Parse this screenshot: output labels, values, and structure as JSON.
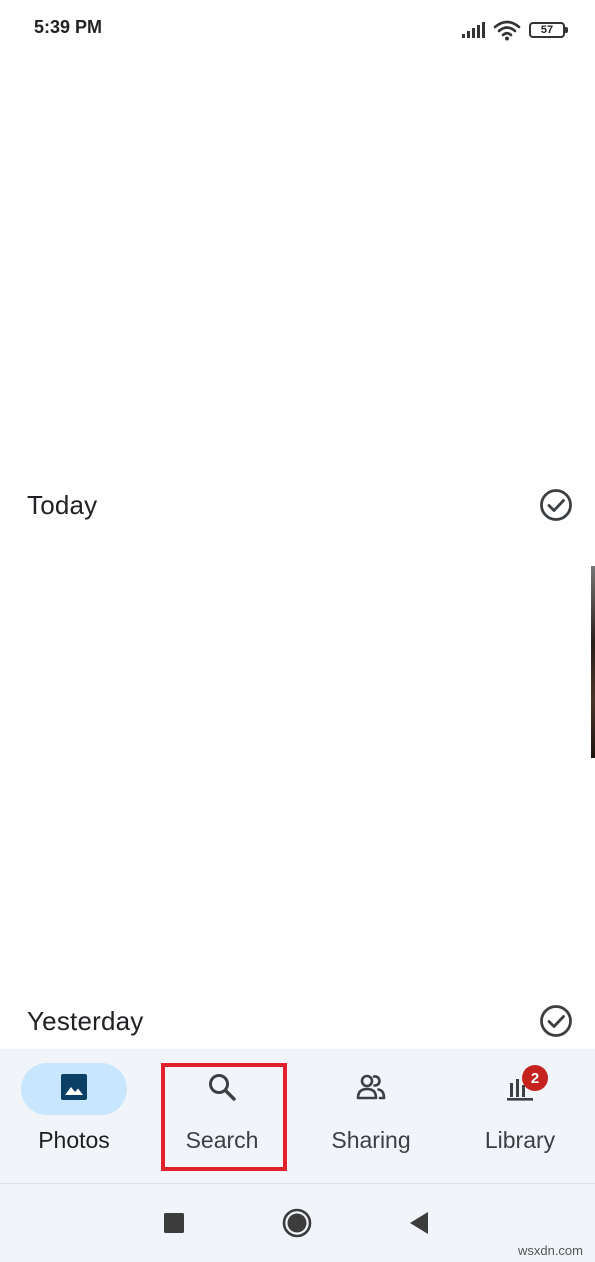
{
  "status_bar": {
    "time": "5:39 PM",
    "battery_level": "57"
  },
  "timeline": {
    "sections": [
      {
        "title": "Today"
      },
      {
        "title": "Yesterday"
      }
    ]
  },
  "bottom_nav": {
    "items": [
      {
        "label": "Photos",
        "icon": "photo-icon",
        "active": true
      },
      {
        "label": "Search",
        "icon": "search-icon",
        "active": false
      },
      {
        "label": "Sharing",
        "icon": "people-icon",
        "active": false
      },
      {
        "label": "Library",
        "icon": "library-icon",
        "active": false,
        "badge": "2"
      }
    ]
  },
  "system_nav": {
    "buttons": [
      "recents",
      "home",
      "back"
    ]
  },
  "watermark": "wsxdn.com",
  "colors": {
    "active_pill": "#c8e6fd",
    "nav_background": "#f1f4f9",
    "badge": "#c5221f",
    "highlight": "#e3202b",
    "text_primary": "#202124"
  }
}
